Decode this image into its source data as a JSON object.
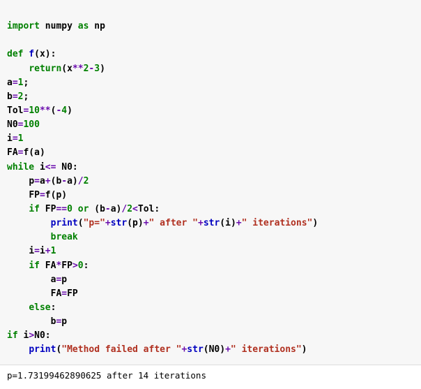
{
  "code": {
    "l1": {
      "kw_import": "import",
      "mod": " numpy ",
      "kw_as": "as",
      "alias": " np"
    },
    "l3": {
      "kw_def": "def",
      "fname": " f",
      "paren_open": "(",
      "arg": "x",
      "paren_close": "):"
    },
    "l4": {
      "kw_return": "return",
      "open": "(x",
      "op1": "**",
      "n2": "2",
      "op2": "-",
      "n3": "3",
      "close": ")"
    },
    "l5": {
      "lhs": "a",
      "eq": "=",
      "val": "1",
      "semi": ";"
    },
    "l6": {
      "lhs": "b",
      "eq": "=",
      "val": "2",
      "semi": ";"
    },
    "l7": {
      "lhs": "Tol",
      "eq": "=",
      "v10": "10",
      "op": "**",
      "open": "(",
      "neg": "-",
      "v4": "4",
      "close": ")"
    },
    "l8": {
      "lhs": "N0",
      "eq": "=",
      "val": "100"
    },
    "l9": {
      "lhs": "i",
      "eq": "=",
      "val": "1"
    },
    "l10": {
      "lhs": "FA",
      "eq": "=",
      "rhs": "f(a)"
    },
    "l11": {
      "kw_while": "while",
      "lhs": " i",
      "op": "<=",
      "rhs": " N0:"
    },
    "l12": {
      "lhs": "p",
      "eq": "=",
      "a": "a",
      "plus": "+",
      "open": "(b",
      "minus": "-",
      "aclose": "a)",
      "div": "/",
      "two": "2"
    },
    "l13": {
      "lhs": "FP",
      "eq": "=",
      "rhs": "f(p)"
    },
    "l14": {
      "kw_if": "if",
      "c1": " FP",
      "op_eq": "==",
      "zero": "0",
      "kw_or": "or",
      "open": " (b",
      "minus": "-",
      "aclose": "a)",
      "div": "/",
      "two": "2",
      "lt": "<",
      "rhs": "Tol:"
    },
    "l15": {
      "fn_print": "print",
      "open": "(",
      "s1": "\"p=\"",
      "plus1": "+",
      "fn_str1": "str",
      "p": "(p)",
      "plus2": "+",
      "s2": "\" after \"",
      "plus3": "+",
      "fn_str2": "str",
      "i": "(i)",
      "plus4": "+",
      "s3": "\" iterations\"",
      "close": ")"
    },
    "l16": {
      "kw_break": "break"
    },
    "l17": {
      "lhs": "i",
      "eq": "=",
      "i2": "i",
      "plus": "+",
      "one": "1"
    },
    "l18": {
      "kw_if": "if",
      "lhs": " FA",
      "op_mul": "*",
      "fp": "FP",
      "gt": ">",
      "zero": "0",
      "colon": ":"
    },
    "l19": {
      "lhs": "a",
      "eq": "=",
      "rhs": "p"
    },
    "l20": {
      "lhs": "FA",
      "eq": "=",
      "rhs": "FP"
    },
    "l21": {
      "kw_else": "else",
      "colon": ":"
    },
    "l22": {
      "lhs": "b",
      "eq": "=",
      "rhs": "p"
    },
    "l23": {
      "kw_if": "if",
      "lhs": " i",
      "gt": ">",
      "rhs": "N0:"
    },
    "l24": {
      "fn_print": "print",
      "open": "(",
      "s1": "\"Method failed after \"",
      "plus1": "+",
      "fn_str": "str",
      "n0": "(N0)",
      "plus2": "+",
      "s2": "\" iterations\"",
      "close": ")"
    }
  },
  "output": "p=1.73199462890625 after 14 iterations"
}
